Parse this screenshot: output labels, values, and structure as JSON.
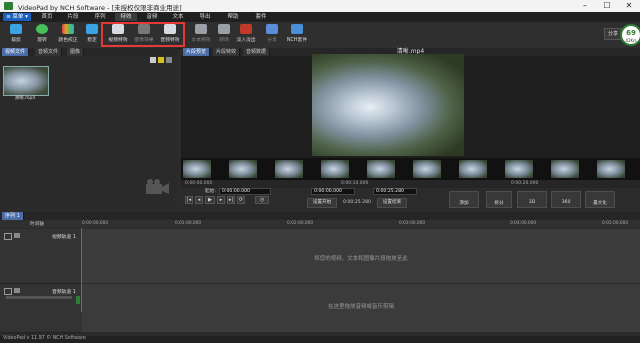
{
  "window": {
    "title": "VideoPad by NCH Software - [未授权仅限非商业用途]"
  },
  "menubar": {
    "menu_button": "≡ 菜单 ▾",
    "items": [
      {
        "label": "首页",
        "active": false
      },
      {
        "label": "片段",
        "active": false
      },
      {
        "label": "序列",
        "active": false
      },
      {
        "label": "特效",
        "active": true
      },
      {
        "label": "音频",
        "active": false
      },
      {
        "label": "文本",
        "active": false
      },
      {
        "label": "导出",
        "active": false
      },
      {
        "label": "帮助",
        "active": false
      },
      {
        "label": "套件",
        "active": false
      }
    ]
  },
  "toolbar": {
    "buttons": [
      {
        "label": "裁剪",
        "icon": "crop-icon",
        "color": "#3aa3e3",
        "dim": false
      },
      {
        "label": "旋转",
        "icon": "rotate-icon",
        "color": "#47c15a",
        "dim": false
      },
      {
        "label": "颜色校正",
        "icon": "color-correction-icon",
        "color": "#e0a030",
        "dim": false
      },
      {
        "label": "稳定",
        "icon": "stabilize-icon",
        "color": "#3aa3e3",
        "dim": false
      },
      {
        "label": "视频特效",
        "icon": "video-effects-icon",
        "color": "#d7dce2",
        "dim": false
      },
      {
        "label": "图像效果",
        "icon": "image-effects-icon",
        "color": "#888888",
        "dim": true
      },
      {
        "label": "音频特效",
        "icon": "audio-effects-icon",
        "color": "#d7dce2",
        "dim": false
      },
      {
        "label": "文本特效",
        "icon": "text-effects-icon",
        "color": "#9aa0a6",
        "dim": true
      },
      {
        "label": "转场",
        "icon": "transition-icon",
        "color": "#9aa0a6",
        "dim": true
      },
      {
        "label": "淡入淡出",
        "icon": "fade-icon",
        "color": "#c0392b",
        "dim": false
      },
      {
        "label": "分享",
        "icon": "share-icon",
        "color": "#5b8dd8",
        "dim": true
      },
      {
        "label": "NCH套件",
        "icon": "nch-suite-icon",
        "color": "#4a90d9",
        "dim": false
      }
    ],
    "share_label": "分享",
    "progress": {
      "value": "69",
      "unit": "%",
      "speed": "42K/s"
    }
  },
  "bin": {
    "tabs": [
      {
        "label": "视频文件",
        "active": true
      },
      {
        "label": "音频文件",
        "active": false
      },
      {
        "label": "图像",
        "active": false
      }
    ],
    "clip_name": "清晰.mp4"
  },
  "preview": {
    "tabs": [
      {
        "label": "片段预览",
        "active": true
      },
      {
        "label": "片段特效",
        "active": false
      },
      {
        "label": "音频数据",
        "active": false
      }
    ],
    "title": "清晰.mp4",
    "timecodes": [
      "0:00:00.000",
      "0:00:10.000",
      "0:00:20.000"
    ],
    "start_label": "起始:",
    "start_value": "0:00:00.000",
    "duration_value": "0:00:25.280",
    "current_value": "0:00:00.000",
    "end_value": "0:00:25.280",
    "set_start": "设置开始",
    "set_end": "设置结束",
    "buttons": [
      "添加",
      "拆分",
      "3D",
      "360",
      "最大化"
    ]
  },
  "sequence": {
    "tab_label": "序列 1",
    "toolbar_label": "时间轴",
    "ruler": [
      "0:00:00.000",
      "0:01:00.000",
      "0:02:00.000",
      "0:03:00.000",
      "0:04:00.000",
      "0:05:00.000"
    ],
    "video_track": "视频轨道 1",
    "audio_track": "音频轨道 1",
    "video_hint": "将您的视频、文本和图像片段拖放至此",
    "audio_hint": "在这里拖放音频或音乐剪辑"
  },
  "status": {
    "text": "VideoPad v 11.97 © NCH Software"
  }
}
